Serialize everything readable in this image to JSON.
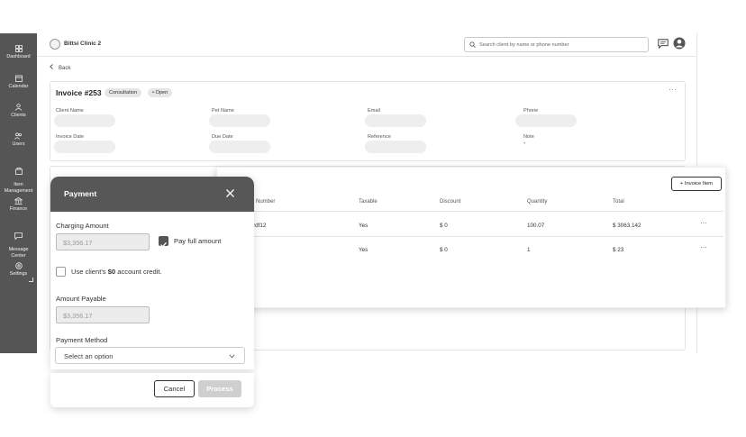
{
  "sidebar": {
    "items": [
      {
        "label": "Dashboard",
        "icon": "dashboard-icon"
      },
      {
        "label": "Calendar",
        "icon": "calendar-icon"
      },
      {
        "label": "Clients",
        "icon": "clients-icon"
      },
      {
        "label": "Users",
        "icon": "users-icon"
      },
      {
        "label": "Item\nManagement",
        "icon": "item-management-icon"
      },
      {
        "label": "Finance",
        "icon": "finance-icon"
      },
      {
        "label": "Message\nCenter",
        "icon": "message-center-icon"
      },
      {
        "label": "Settings",
        "icon": "settings-icon"
      }
    ]
  },
  "header": {
    "clinic_name": "Bittsi Clinic 2",
    "search_placeholder": "Search client by name or phone number"
  },
  "back_label": "Back",
  "invoice": {
    "title": "Invoice #253",
    "type_badge": "Consultation",
    "status_badge": "Open",
    "fields": {
      "client_name_label": "Client Name",
      "pet_name_label": "Pet Name",
      "email_label": "Email",
      "phone_label": "Phone",
      "invoice_date_label": "Invoice Date",
      "due_date_label": "Due Date",
      "reference_label": "Reference",
      "note_label": "Note",
      "note_value": "-"
    }
  },
  "items": {
    "add_button": "+ Invoice Item",
    "columns": [
      "Number",
      "Taxable",
      "Discount",
      "Quantity",
      "Total"
    ],
    "rows": [
      {
        "number": "zdf12",
        "taxable": "Yes",
        "discount": "$ 0",
        "quantity": "100.07",
        "total": "$ 3063.142"
      },
      {
        "number": "",
        "taxable": "Yes",
        "discount": "$ 0",
        "quantity": "1",
        "total": "$ 23"
      }
    ]
  },
  "payment": {
    "title": "Payment",
    "charging_amount_label": "Charging Amount",
    "charging_amount_value": "$3,356.17",
    "pay_full_label": "Pay full amount",
    "pay_full_checked": true,
    "credit_prefix": "Use client's ",
    "credit_amount": "$0",
    "credit_suffix": " account credit.",
    "credit_checked": false,
    "amount_payable_label": "Amount Payable",
    "amount_payable_value": "$3,356.17",
    "payment_method_label": "Payment Method",
    "payment_method_placeholder": "Select an option",
    "cancel_label": "Cancel",
    "process_label": "Process"
  }
}
